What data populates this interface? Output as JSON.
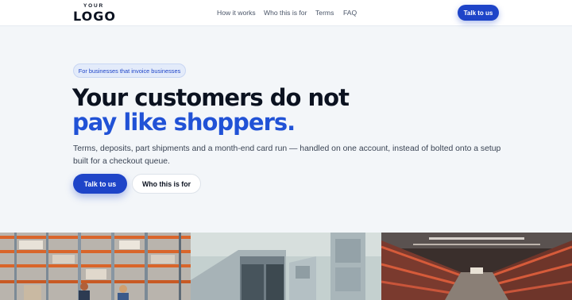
{
  "header": {
    "logo_top": "YOUR",
    "logo_main": "LOGO",
    "nav": [
      "How it works",
      "Who this is for",
      "Terms",
      "FAQ"
    ],
    "cta": "Talk to us"
  },
  "hero": {
    "badge": "For businesses that invoice businesses",
    "headline_line1": "Your customers do not",
    "headline_line2": "pay like shoppers.",
    "lead": "Terms, deposits, part shipments and a month-end card run — handled on one account, instead of bolted onto a setup built for a checkout queue.",
    "primary_button": "Talk to us",
    "secondary_button": "Who this is for"
  },
  "photos": [
    {
      "subject": "warehouse-shelving-workers"
    },
    {
      "subject": "delivery-van-open-doors"
    },
    {
      "subject": "warehouse-aisle-racks"
    }
  ],
  "colors": {
    "accent": "#1e44c8",
    "headline_accent": "#2152d6",
    "background": "#f3f6f9"
  }
}
